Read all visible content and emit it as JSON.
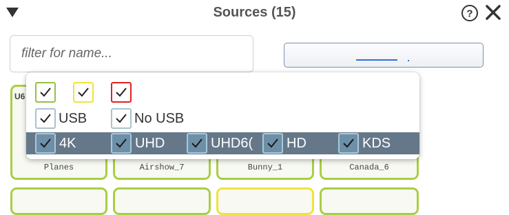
{
  "header": {
    "title": "Sources (15)",
    "icons": [
      "filter-icon",
      "help-icon",
      "close-icon"
    ]
  },
  "filter": {
    "placeholder": "filter for name..."
  },
  "colors": {
    "green": "#96c043",
    "yellow": "#f1e33b",
    "red": "#e02121",
    "tile_border": "#a8cf42",
    "dark_row": "#65788a",
    "button_accent": "#2d6fe0"
  },
  "tiles": [
    {
      "caption": "Planes",
      "tag": "U6"
    },
    {
      "caption": "Airshow_7"
    },
    {
      "caption": "Bunny_1"
    },
    {
      "caption": "Canada_6"
    }
  ],
  "popup": {
    "color_checks": [
      "green",
      "yellow",
      "red"
    ],
    "usb_options": [
      {
        "label": "USB",
        "checked": true
      },
      {
        "label": "No USB",
        "checked": true
      }
    ],
    "resolution_options": [
      {
        "label": "4K",
        "checked": true
      },
      {
        "label": "UHD",
        "checked": true
      },
      {
        "label": "UHD6(",
        "checked": true
      },
      {
        "label": "HD",
        "checked": true
      },
      {
        "label": "KDS",
        "checked": true
      }
    ]
  }
}
